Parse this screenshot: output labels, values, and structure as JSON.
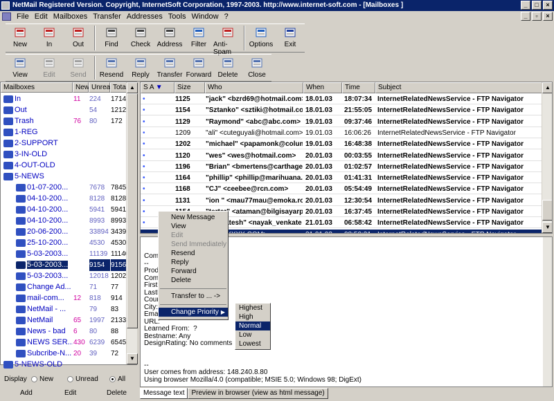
{
  "window": {
    "title": "NetMail Registered Version. Copyright, InternetSoft Corporation, 1997-2003. http://www.internet-soft.com - [Mailboxes ]"
  },
  "menu": [
    "File",
    "Edit",
    "Mailboxes",
    "Transfer",
    "Addresses",
    "Tools",
    "Window",
    "?"
  ],
  "toolbar1": [
    {
      "label": "New",
      "icon": "new-mail-icon",
      "color": "#c02020"
    },
    {
      "label": "In",
      "icon": "inbox-icon",
      "color": "#c02020"
    },
    {
      "label": "Out",
      "icon": "outbox-icon",
      "color": "#c02020"
    },
    {
      "label": "Find",
      "icon": "find-icon",
      "color": "#404040"
    },
    {
      "label": "Check",
      "icon": "check-icon",
      "color": "#404040"
    },
    {
      "label": "Address",
      "icon": "address-book-icon",
      "color": "#404040"
    },
    {
      "label": "Filter",
      "icon": "filter-icon",
      "color": "#2060c0"
    },
    {
      "label": "Anti-Spam",
      "icon": "anti-spam-icon",
      "color": "#c02020"
    },
    {
      "label": "Options",
      "icon": "options-icon",
      "color": "#2060c0"
    },
    {
      "label": "Exit",
      "icon": "exit-icon",
      "color": "#2040a0"
    }
  ],
  "toolbar2": [
    {
      "label": "View",
      "icon": "view-icon",
      "disabled": false
    },
    {
      "label": "Edit",
      "icon": "edit-icon",
      "disabled": true
    },
    {
      "label": "Send",
      "icon": "send-icon",
      "disabled": true
    },
    {
      "label": "Resend",
      "icon": "resend-icon",
      "disabled": false
    },
    {
      "label": "Reply",
      "icon": "reply-icon",
      "disabled": false
    },
    {
      "label": "Transfer",
      "icon": "transfer-icon",
      "disabled": false
    },
    {
      "label": "Forward",
      "icon": "forward-icon",
      "disabled": false
    },
    {
      "label": "Delete",
      "icon": "delete-icon",
      "disabled": false
    },
    {
      "label": "Close",
      "icon": "close-icon",
      "disabled": false
    }
  ],
  "mailboxes": {
    "headers": {
      "name": "Mailboxes",
      "new": "New",
      "unread": "Unread",
      "total": "Total"
    },
    "rows": [
      {
        "name": "In",
        "new": "11",
        "unread": "224",
        "total": "1714",
        "level": 0
      },
      {
        "name": "Out",
        "new": "",
        "unread": "54",
        "total": "1212",
        "level": 0
      },
      {
        "name": "Trash",
        "new": "76",
        "unread": "80",
        "total": "172",
        "level": 0
      },
      {
        "name": "1-REG",
        "new": "",
        "unread": "",
        "total": "",
        "level": 0
      },
      {
        "name": "2-SUPPORT",
        "new": "",
        "unread": "",
        "total": "",
        "level": 0
      },
      {
        "name": "3-IN-OLD",
        "new": "",
        "unread": "",
        "total": "",
        "level": 0
      },
      {
        "name": "4-OUT-OLD",
        "new": "",
        "unread": "",
        "total": "",
        "level": 0
      },
      {
        "name": "5-NEWS",
        "new": "",
        "unread": "",
        "total": "",
        "level": 0
      },
      {
        "name": "01-07-200...",
        "new": "",
        "unread": "7678",
        "total": "7845",
        "level": 1
      },
      {
        "name": "04-10-200...",
        "new": "",
        "unread": "8128",
        "total": "8128",
        "level": 1
      },
      {
        "name": "04-10-200...",
        "new": "",
        "unread": "5941",
        "total": "5941",
        "level": 1
      },
      {
        "name": "04-10-200...",
        "new": "",
        "unread": "8993",
        "total": "8993",
        "level": 1
      },
      {
        "name": "20-06-200...",
        "new": "",
        "unread": "33894",
        "total": "34398",
        "level": 1
      },
      {
        "name": "25-10-200...",
        "new": "",
        "unread": "4530",
        "total": "4530",
        "level": 1
      },
      {
        "name": "5-03-2003...",
        "new": "",
        "unread": "11139",
        "total": "11140",
        "level": 1
      },
      {
        "name": "5-03-2003...",
        "new": "",
        "unread": "9154",
        "total": "9156",
        "level": 1,
        "selected": true
      },
      {
        "name": "5-03-2003...",
        "new": "",
        "unread": "12018",
        "total": "12021",
        "level": 1
      },
      {
        "name": "Change Ad...",
        "new": "",
        "unread": "71",
        "total": "77",
        "level": 1
      },
      {
        "name": "mail-com...",
        "new": "12",
        "unread": "818",
        "total": "914",
        "level": 1
      },
      {
        "name": "NetMail - ...",
        "new": "",
        "unread": "79",
        "total": "83",
        "level": 1
      },
      {
        "name": "NetMail",
        "new": "65",
        "unread": "1997",
        "total": "2133",
        "level": 1
      },
      {
        "name": "News - bad",
        "new": "6",
        "unread": "80",
        "total": "88",
        "level": 1
      },
      {
        "name": "NEWS SER...",
        "new": "430",
        "unread": "6239",
        "total": "6545",
        "level": 1
      },
      {
        "name": "Subcribe-N...",
        "new": "20",
        "unread": "39",
        "total": "72",
        "level": 1
      },
      {
        "name": "5-NEWS-OLD",
        "new": "",
        "unread": "",
        "total": "",
        "level": 0
      }
    ]
  },
  "bottom_left": {
    "display_label": "Display",
    "radio_new": "New",
    "radio_unread": "Unread",
    "radio_all": "All",
    "add": "Add",
    "edit": "Edit",
    "delete": "Delete"
  },
  "messages": {
    "headers": {
      "sa": "S A",
      "size": "Size",
      "who": "Who",
      "when": "When",
      "time": "Time",
      "subject": "Subject"
    },
    "rows": [
      {
        "bold": true,
        "size": "1125",
        "who": "\"jack\" <bzrd69@hotmail.com>",
        "when": "18.01.03",
        "time": "18:07:34",
        "subject": "InternetRelatedNewsService - FTP Navigator"
      },
      {
        "bold": true,
        "size": "1154",
        "who": "\"Sztanko\" <sztiki@hotmail.co",
        "when": "18.01.03",
        "time": "21:55:05",
        "subject": "InternetRelatedNewsService - FTP Navigator"
      },
      {
        "bold": true,
        "size": "1129",
        "who": "\"Raymond\" <abc@abc.com>",
        "when": "19.01.03",
        "time": "09:37:46",
        "subject": "InternetRelatedNewsService - FTP Navigator"
      },
      {
        "bold": false,
        "size": "1209",
        "who": "\"ali\" <cuteguyali@hotmail.com>",
        "when": "19.01.03",
        "time": "16:06:26",
        "subject": "InternetRelatedNewsService - FTP Navigator"
      },
      {
        "bold": true,
        "size": "1202",
        "who": "\"michael\" <papamonk@colum",
        "when": "19.01.03",
        "time": "16:48:38",
        "subject": "InternetRelatedNewsService - FTP Navigator"
      },
      {
        "bold": true,
        "size": "1120",
        "who": "\"wes\" <wes@hotmail.com>",
        "when": "20.01.03",
        "time": "00:03:55",
        "subject": "InternetRelatedNewsService - FTP Navigator"
      },
      {
        "bold": true,
        "size": "1196",
        "who": "\"Brian\" <bmertens@carthage_",
        "when": "20.01.03",
        "time": "01:02:57",
        "subject": "InternetRelatedNewsService - FTP Navigator"
      },
      {
        "bold": true,
        "size": "1164",
        "who": "\"phillip\" <phillip@marihuana.r",
        "when": "20.01.03",
        "time": "01:41:31",
        "subject": "InternetRelatedNewsService - FTP Navigator"
      },
      {
        "bold": true,
        "size": "1168",
        "who": "\"CJ\" <ceebee@rcn.com>",
        "when": "20.01.03",
        "time": "05:54:49",
        "subject": "InternetRelatedNewsService - FTP Navigator"
      },
      {
        "bold": true,
        "size": "1131",
        "who": "\"ion \" <mau77mau@emoka.ro",
        "when": "20.01.03",
        "time": "12:30:54",
        "subject": "InternetRelatedNewsService - FTP Navigator"
      },
      {
        "bold": true,
        "size": "1154",
        "who": "\"terter\" <ataman@bilgisayarp",
        "when": "20.01.03",
        "time": "16:37:45",
        "subject": "InternetRelatedNewsService - FTP Navigator"
      },
      {
        "bold": true,
        "size": "1154",
        "who": "\"Venkatesh\" <nayak_venkate",
        "when": "21.01.03",
        "time": "06:58:42",
        "subject": "InternetRelatedNewsService - FTP Navigator"
      },
      {
        "bold": false,
        "selected": true,
        "size": "",
        "who": "XXX@XXXX.COM>",
        "when": "21.01.03",
        "time": "08:50:21",
        "subject": "InternetRelatedNewsService - FTP Navigator"
      }
    ]
  },
  "preview_lines": [
    "",
    "",
    "Comm",
    "--",
    "Produ",
    "Comp",
    "FirstN",
    "LastN",
    "Coun",
    "City:",
    "Email",
    "URL:",
    "Learned From:  ?",
    "Bestname: Any",
    "DesignRating: No comments",
    "",
    "",
    "--",
    "User comes from address: 148.240.8.80",
    "Using browser Mozilla/4.0 (compatible; MSIE 5.0; Windows 98; DigExt)"
  ],
  "context_menu": {
    "items": [
      "New Message",
      "View",
      "Edit",
      "Send Immediately",
      "Resend",
      "Reply",
      "Forward",
      "Delete",
      "Transfer to ... ->",
      "Change Priority"
    ],
    "disabled": [
      false,
      false,
      true,
      true,
      false,
      false,
      false,
      false,
      false,
      false
    ]
  },
  "priority_menu": {
    "items": [
      "Highest",
      "High",
      "Normal",
      "Low",
      "Lowest"
    ],
    "selected_index": 2
  },
  "tabs": [
    "Message text",
    "Preview in browser (view as html message)"
  ]
}
